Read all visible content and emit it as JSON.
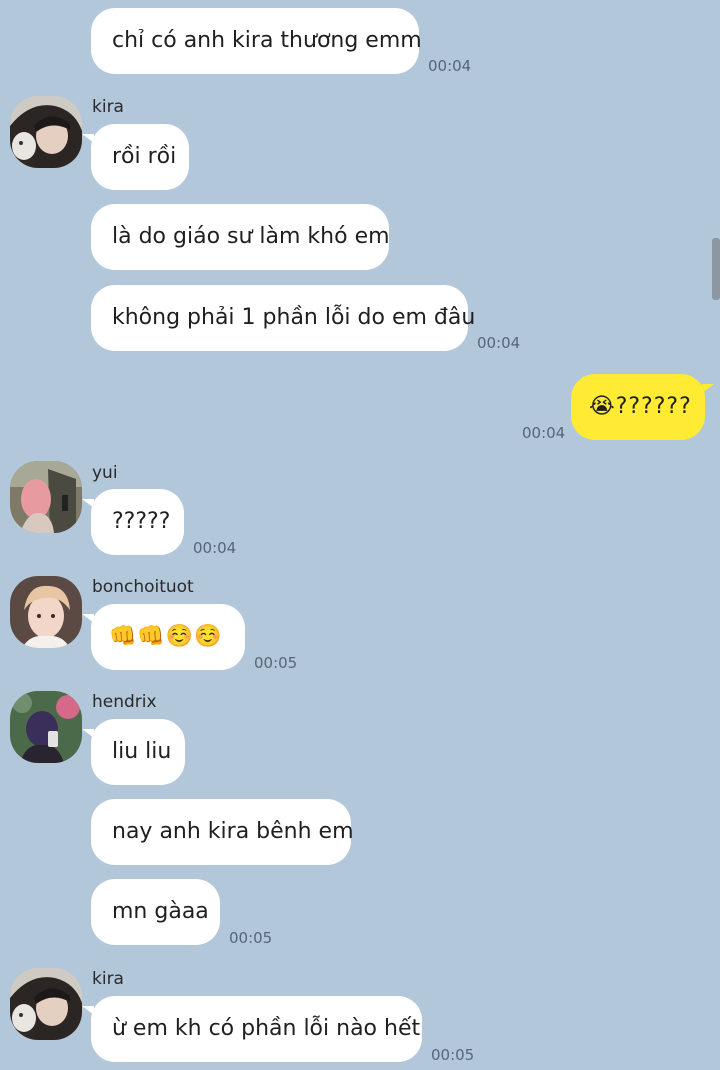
{
  "colors": {
    "background": "#b2c7da",
    "incoming_bubble": "#ffffff",
    "outgoing_bubble": "#ffeb33"
  },
  "messages": {
    "m1": {
      "text": "chỉ có anh kira thương emm",
      "time": "00:04"
    },
    "g_kira1": {
      "sender": "kira",
      "avatar_icon": "kira-avatar",
      "texts": [
        "rồi rồi",
        "là do giáo sư làm khó em",
        "không phải 1 phần lỗi do em đâu"
      ],
      "time": "00:04"
    },
    "mine1": {
      "text": "😭??????",
      "time": "00:04"
    },
    "g_yui": {
      "sender": "yui",
      "avatar_icon": "yui-avatar",
      "texts": [
        "?????"
      ],
      "time": "00:04"
    },
    "g_bon": {
      "sender": "bonchoituot",
      "avatar_icon": "bonchoituot-avatar",
      "texts": [
        "👊👊☺️☺️"
      ],
      "time": "00:05"
    },
    "g_hendrix": {
      "sender": "hendrix",
      "avatar_icon": "hendrix-avatar",
      "texts": [
        "liu liu",
        "nay anh kira bênh em",
        "mn gàaa"
      ],
      "time": "00:05"
    },
    "g_kira2": {
      "sender": "kira",
      "avatar_icon": "kira-avatar",
      "texts": [
        "ừ  em kh có phần lỗi nào hết"
      ],
      "time": "00:05"
    }
  }
}
